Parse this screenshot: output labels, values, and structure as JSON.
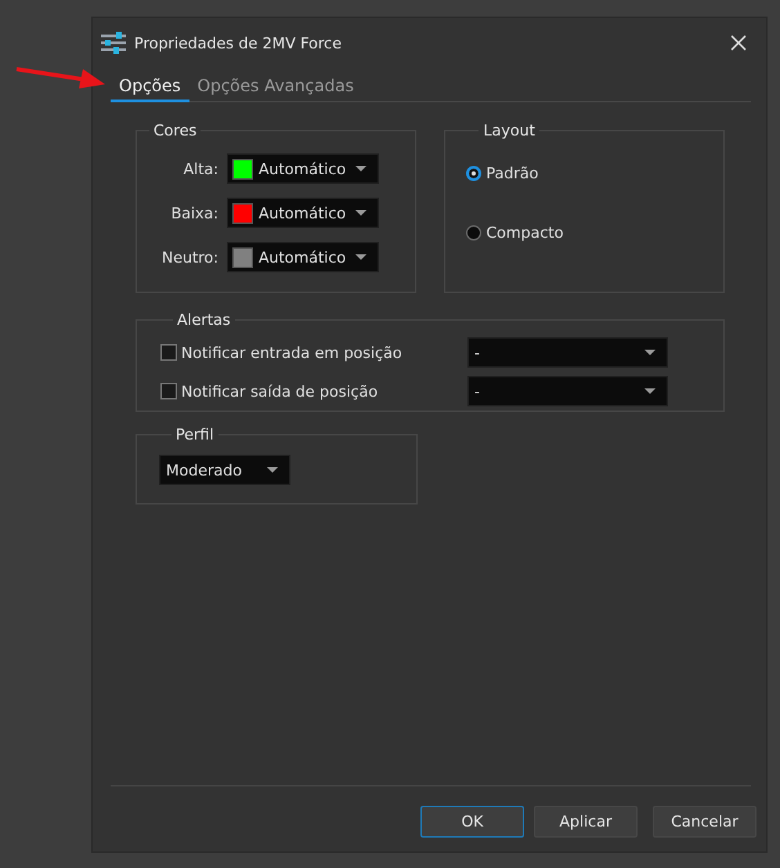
{
  "window": {
    "title": "Propriedades de 2MV Force"
  },
  "tabs": [
    {
      "label": "Opções",
      "selected": true
    },
    {
      "label": "Opções Avançadas",
      "selected": false
    }
  ],
  "cores": {
    "title": "Cores",
    "rows": [
      {
        "label": "Alta:",
        "color": "#00ff00",
        "value": "Automático"
      },
      {
        "label": "Baixa:",
        "color": "#ff0000",
        "value": "Automático"
      },
      {
        "label": "Neutro:",
        "color": "#808080",
        "value": "Automático"
      }
    ]
  },
  "layout": {
    "title": "Layout",
    "options": [
      {
        "label": "Padrão",
        "selected": true
      },
      {
        "label": "Compacto",
        "selected": false
      }
    ]
  },
  "alertas": {
    "title": "Alertas",
    "items": [
      {
        "label": "Notificar entrada em posição",
        "checked": false,
        "value": "-"
      },
      {
        "label": "Notificar saída de posição",
        "checked": false,
        "value": "-"
      }
    ]
  },
  "perfil": {
    "title": "Perfil",
    "value": "Moderado"
  },
  "buttons": [
    {
      "label": "OK",
      "focused": true
    },
    {
      "label": "Aplicar",
      "focused": false
    },
    {
      "label": "Cancelar",
      "focused": false
    }
  ]
}
